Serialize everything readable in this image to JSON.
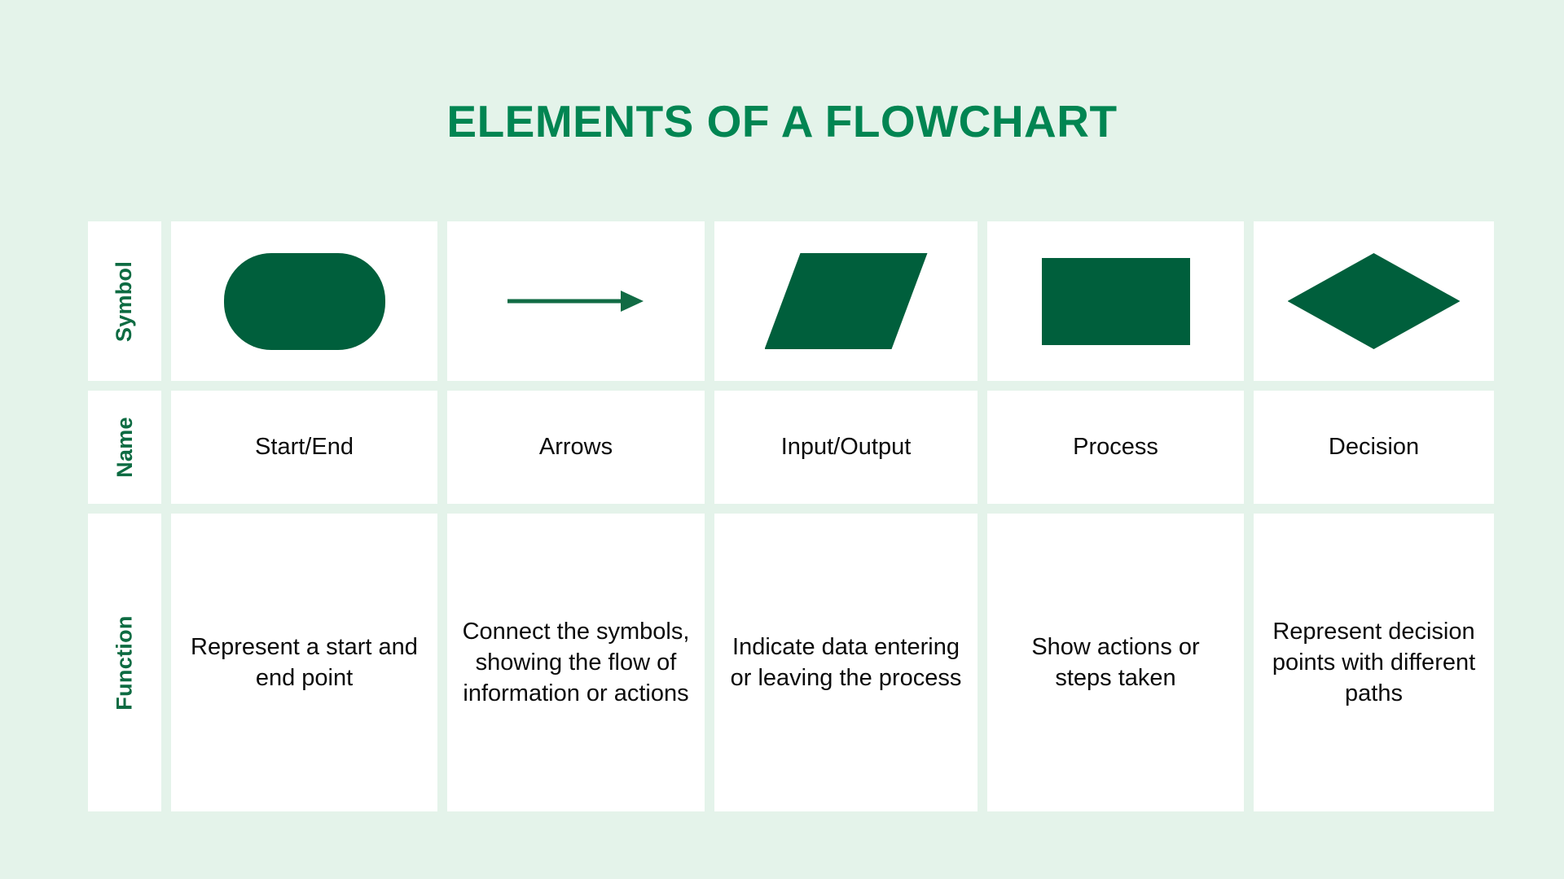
{
  "page": {
    "title": "Elements of a Flowchart",
    "background_color": "#e4f3ea",
    "title_color": "#018552",
    "shape_color": "#005f3c",
    "label_color": "#0d6b42",
    "cell_background": "#ffffff"
  },
  "row_labels": [
    {
      "key": "symbol",
      "label": "Symbol"
    },
    {
      "key": "name",
      "label": "Name"
    },
    {
      "key": "function",
      "label": "Function"
    }
  ],
  "columns": [
    {
      "symbol_shape": "rounded-rectangle",
      "name": "Start/End",
      "function": "Represent a start and end point"
    },
    {
      "symbol_shape": "arrow",
      "name": "Arrows",
      "function": "Connect the symbols, showing the flow of information or actions"
    },
    {
      "symbol_shape": "parallelogram",
      "name": "Input/Output",
      "function": "Indicate data entering or leaving the process"
    },
    {
      "symbol_shape": "rectangle",
      "name": "Process",
      "function": "Show actions or steps taken"
    },
    {
      "symbol_shape": "diamond",
      "name": "Decision",
      "function": "Represent decision points with different paths"
    }
  ]
}
